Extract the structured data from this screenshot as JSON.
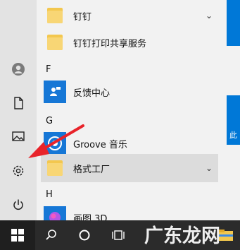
{
  "start_menu": {
    "app_list": [
      {
        "label": "钉钉",
        "type": "folder",
        "expandable": true
      },
      {
        "label": "钉钉打印共享服务",
        "type": "folder",
        "expandable": false
      },
      {
        "label": "反馈中心",
        "type": "app",
        "icon": "feedback-hub-icon",
        "expandable": false
      },
      {
        "label": "Groove 音乐",
        "type": "app",
        "icon": "groove-music-icon",
        "expandable": false
      },
      {
        "label": "格式工厂",
        "type": "folder",
        "expandable": true
      },
      {
        "label": "画图 3D",
        "type": "app",
        "icon": "paint-3d-icon",
        "expandable": false
      }
    ],
    "section_letters": [
      "F",
      "G",
      "H"
    ],
    "rail_icons": [
      "user-avatar-icon",
      "documents-icon",
      "pictures-icon",
      "settings-icon",
      "power-icon"
    ],
    "tile_letter": "此"
  },
  "taskbar": {
    "icons": [
      "windows-start-icon",
      "search-icon",
      "cortana-icon",
      "task-view-icon",
      "file-explorer-icon"
    ]
  },
  "watermark": {
    "text": "广东龙网"
  },
  "colors": {
    "accent": "#0078d7",
    "folder": "#f3c74e",
    "arrow": "#e8232a",
    "taskbar": "#2b2b2b"
  }
}
